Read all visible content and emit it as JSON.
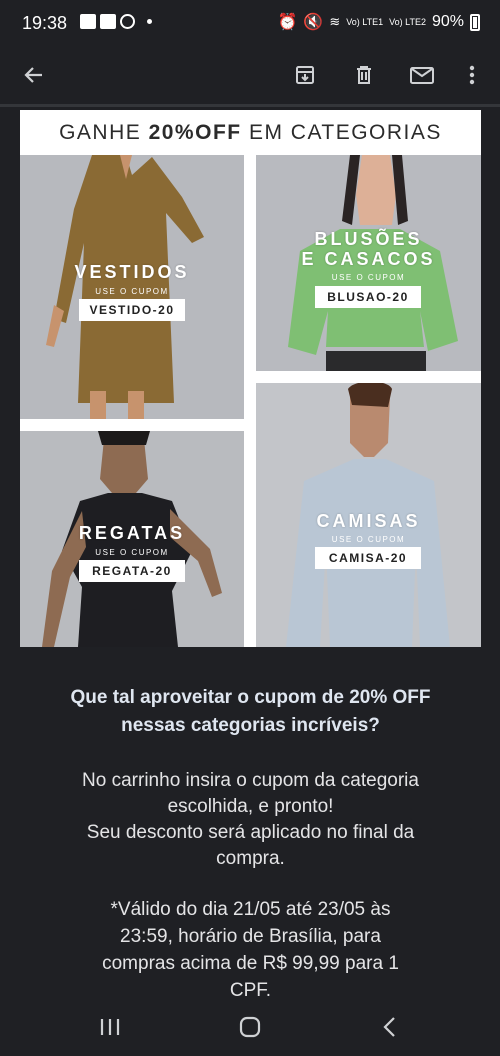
{
  "status_bar": {
    "time": "19:38",
    "battery": "90%",
    "signal_1": "Vo) LTE1",
    "signal_2": "Vo) LTE2"
  },
  "toolbar": {
    "icons": [
      "back-arrow-icon",
      "archive-icon",
      "delete-icon",
      "mark-unread-icon",
      "more-options-icon"
    ]
  },
  "email": {
    "banner": {
      "title_prefix": "GANHE ",
      "title_bold": "20%OFF",
      "title_suffix": " EM CATEGORIAS"
    },
    "tiles": [
      {
        "category": "VESTIDOS",
        "sub": "USE O CUPOM",
        "coupon": "VESTIDO-20"
      },
      {
        "category_line1": "BLUSÕES",
        "category_line2": "E CASACOS",
        "sub": "USE O CUPOM",
        "coupon": "BLUSAO-20"
      },
      {
        "category": "REGATAS",
        "sub": "USE O CUPOM",
        "coupon": "REGATA-20"
      },
      {
        "category": "CAMISAS",
        "sub": "USE O CUPOM",
        "coupon": "CAMISA-20"
      }
    ],
    "headline_line1": "Que tal aproveitar o cupom de 20% OFF",
    "headline_line2": "nessas categorias incríveis?",
    "instructions": [
      "No carrinho insira o cupom da categoria",
      "escolhida, e pronto!",
      "Seu desconto será aplicado no final da",
      "compra."
    ],
    "validity": [
      "*Válido do dia 21/05 até 23/05 às",
      "23:59, horário de Brasília, para",
      "compras acima de R$ 99,99 para 1",
      "CPF."
    ]
  },
  "colors": {
    "background": "#1f2024",
    "dress": "#8a6a34",
    "sweater": "#7fbf73",
    "tank": "#1e1e22",
    "shirt": "#b9c6d4"
  }
}
